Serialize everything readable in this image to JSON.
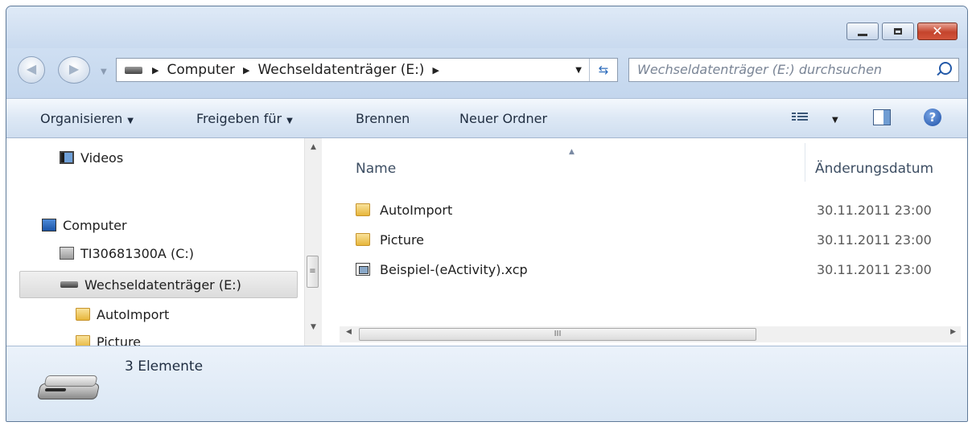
{
  "window": {
    "buttons": {
      "minimize": "minimize",
      "maximize": "maximize",
      "close": "✕"
    }
  },
  "address": {
    "crumbs": [
      "Computer",
      "Wechseldatenträger (E:)"
    ]
  },
  "search": {
    "placeholder": "Wechseldatenträger (E:) durchsuchen"
  },
  "toolbar": {
    "organize": "Organisieren",
    "share": "Freigeben für",
    "burn": "Brennen",
    "new_folder": "Neuer Ordner"
  },
  "nav": {
    "items": [
      {
        "label": "Videos",
        "icon": "video-library-icon"
      },
      {
        "label": "Computer",
        "icon": "computer-icon"
      },
      {
        "label": "TI30681300A (C:)",
        "icon": "hard-drive-icon"
      },
      {
        "label": "Wechseldatenträger (E:)",
        "icon": "removable-drive-icon",
        "selected": true
      },
      {
        "label": "AutoImport",
        "icon": "folder-icon"
      },
      {
        "label": "Picture",
        "icon": "folder-icon"
      }
    ]
  },
  "files": {
    "columns": [
      "Name",
      "Änderungsdatum"
    ],
    "rows": [
      {
        "name": "AutoImport",
        "date": "30.11.2011 23:00",
        "icon": "folder-icon"
      },
      {
        "name": "Picture",
        "date": "30.11.2011 23:00",
        "icon": "folder-icon"
      },
      {
        "name": "Beispiel-(eActivity).xcp",
        "date": "30.11.2011 23:00",
        "icon": "file-icon"
      }
    ]
  },
  "details": {
    "count": "3 Elemente"
  }
}
